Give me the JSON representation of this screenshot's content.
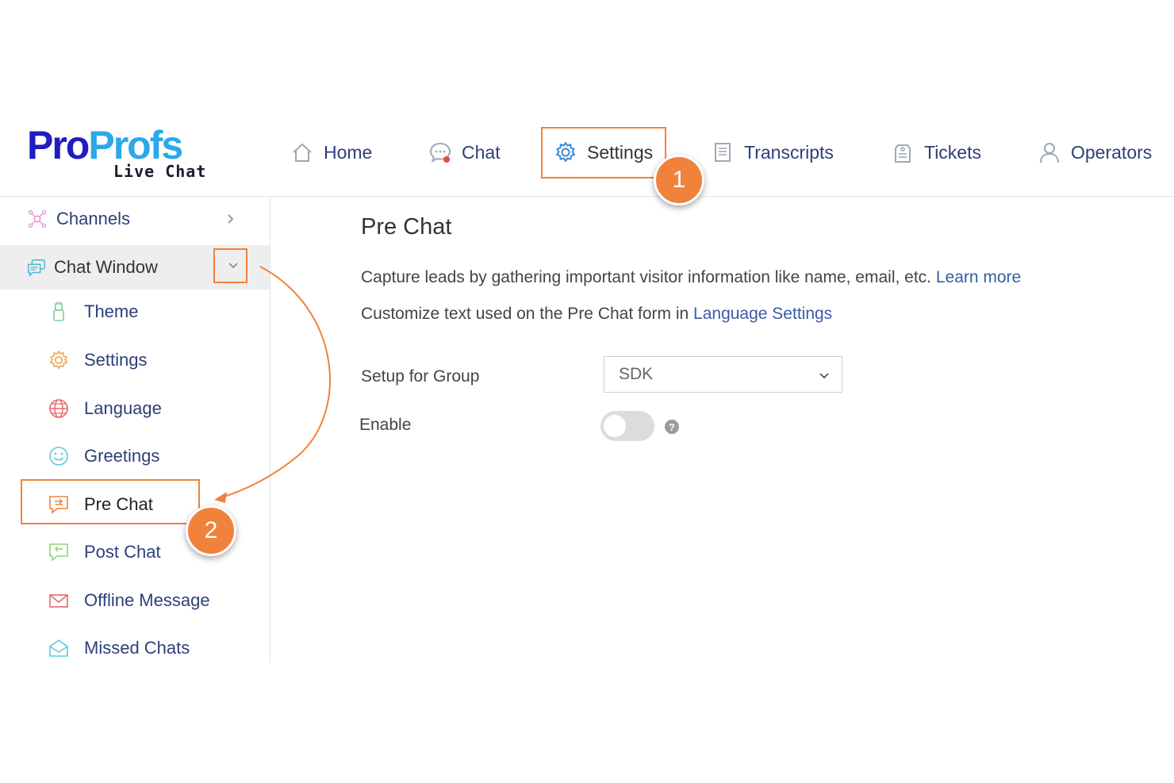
{
  "logo": {
    "pro": "Pro",
    "profs": "Profs",
    "sub": "Live Chat"
  },
  "nav": [
    {
      "label": "Home",
      "icon": "home-icon"
    },
    {
      "label": "Chat",
      "icon": "chat-bubble-icon"
    },
    {
      "label": "Settings",
      "icon": "gear-icon"
    },
    {
      "label": "Transcripts",
      "icon": "document-icon"
    },
    {
      "label": "Tickets",
      "icon": "ticket-icon"
    },
    {
      "label": "Operators",
      "icon": "user-icon"
    }
  ],
  "sidebar": {
    "channels": "Channels",
    "chat_window": "Chat Window",
    "items": [
      {
        "label": "Theme",
        "icon": "theme-icon"
      },
      {
        "label": "Settings",
        "icon": "gear-icon"
      },
      {
        "label": "Language",
        "icon": "globe-icon"
      },
      {
        "label": "Greetings",
        "icon": "smiley-icon"
      },
      {
        "label": "Pre Chat",
        "icon": "pre-chat-icon"
      },
      {
        "label": "Post Chat",
        "icon": "post-chat-icon"
      },
      {
        "label": "Offline Message",
        "icon": "envelope-icon"
      },
      {
        "label": "Missed Chats",
        "icon": "open-envelope-icon"
      }
    ]
  },
  "main": {
    "title": "Pre Chat",
    "line1_text": "Capture leads by gathering important visitor information like name, email, etc. ",
    "line1_link": "Learn more",
    "line2_text": "Customize text used on the Pre Chat form in ",
    "line2_link": "Language Settings",
    "setup_label": "Setup for Group",
    "setup_value": "SDK",
    "enable_label": "Enable",
    "enable_on": false,
    "help_glyph": "?"
  },
  "annotations": {
    "step1": "1",
    "step2": "2"
  },
  "colors": {
    "accent": "#f0823c",
    "nav_text": "#2d3f7a",
    "logo_blue": "#1f1cc2",
    "logo_light": "#2ba8e8"
  }
}
